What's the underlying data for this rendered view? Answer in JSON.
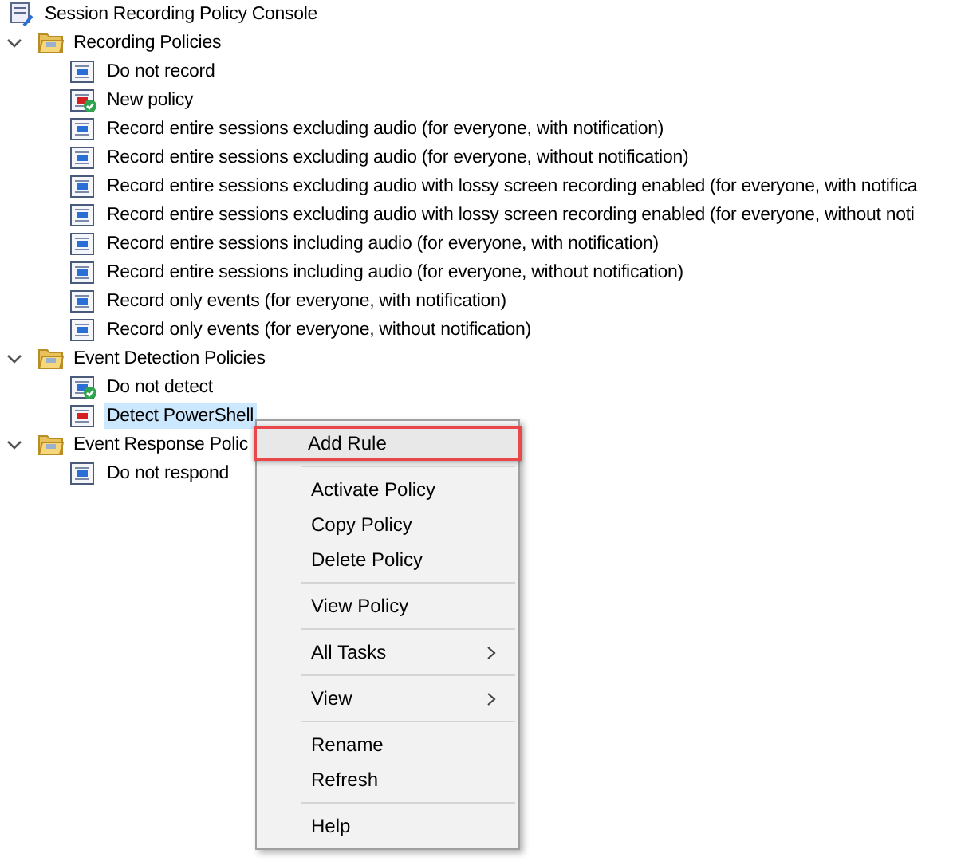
{
  "tree": {
    "title": "Session Recording Policy Console",
    "children": [
      {
        "label": "Recording Policies",
        "expanded": true,
        "children": [
          {
            "label": "Do not record",
            "active": false,
            "selected": false,
            "color": "#2a6fd6"
          },
          {
            "label": "New policy",
            "active": true,
            "selected": false,
            "color": "#d42020"
          },
          {
            "label": "Record entire sessions excluding audio (for everyone, with notification)",
            "active": false,
            "selected": false,
            "color": "#2a6fd6"
          },
          {
            "label": "Record entire sessions excluding audio (for everyone, without notification)",
            "active": false,
            "selected": false,
            "color": "#2a6fd6"
          },
          {
            "label": "Record entire sessions excluding audio with lossy screen recording enabled (for everyone, with notifica",
            "active": false,
            "selected": false,
            "color": "#2a6fd6"
          },
          {
            "label": "Record entire sessions excluding audio with lossy screen recording enabled (for everyone, without noti",
            "active": false,
            "selected": false,
            "color": "#2a6fd6"
          },
          {
            "label": "Record entire sessions including audio (for everyone, with notification)",
            "active": false,
            "selected": false,
            "color": "#2a6fd6"
          },
          {
            "label": "Record entire sessions including audio (for everyone, without notification)",
            "active": false,
            "selected": false,
            "color": "#2a6fd6"
          },
          {
            "label": "Record only events (for everyone, with notification)",
            "active": false,
            "selected": false,
            "color": "#2a6fd6"
          },
          {
            "label": "Record only events (for everyone, without notification)",
            "active": false,
            "selected": false,
            "color": "#2a6fd6"
          }
        ]
      },
      {
        "label": "Event Detection Policies",
        "expanded": true,
        "children": [
          {
            "label": "Do not detect",
            "active": true,
            "selected": false,
            "color": "#2a6fd6"
          },
          {
            "label": "Detect PowerShell",
            "active": false,
            "selected": true,
            "color": "#d42020"
          }
        ]
      },
      {
        "label": "Event Response Polic",
        "expanded": true,
        "children": [
          {
            "label": "Do not respond",
            "active": false,
            "selected": false,
            "color": "#2a6fd6"
          }
        ]
      }
    ]
  },
  "context_menu": {
    "groups": [
      [
        {
          "label": "Add Rule",
          "highlighted": true,
          "submenu": false
        }
      ],
      [
        {
          "label": "Activate Policy",
          "highlighted": false,
          "submenu": false
        },
        {
          "label": "Copy Policy",
          "highlighted": false,
          "submenu": false
        },
        {
          "label": "Delete Policy",
          "highlighted": false,
          "submenu": false
        }
      ],
      [
        {
          "label": "View Policy",
          "highlighted": false,
          "submenu": false
        }
      ],
      [
        {
          "label": "All Tasks",
          "highlighted": false,
          "submenu": true
        }
      ],
      [
        {
          "label": "View",
          "highlighted": false,
          "submenu": true
        }
      ],
      [
        {
          "label": "Rename",
          "highlighted": false,
          "submenu": false
        },
        {
          "label": "Refresh",
          "highlighted": false,
          "submenu": false
        }
      ],
      [
        {
          "label": "Help",
          "highlighted": false,
          "submenu": false
        }
      ]
    ]
  }
}
